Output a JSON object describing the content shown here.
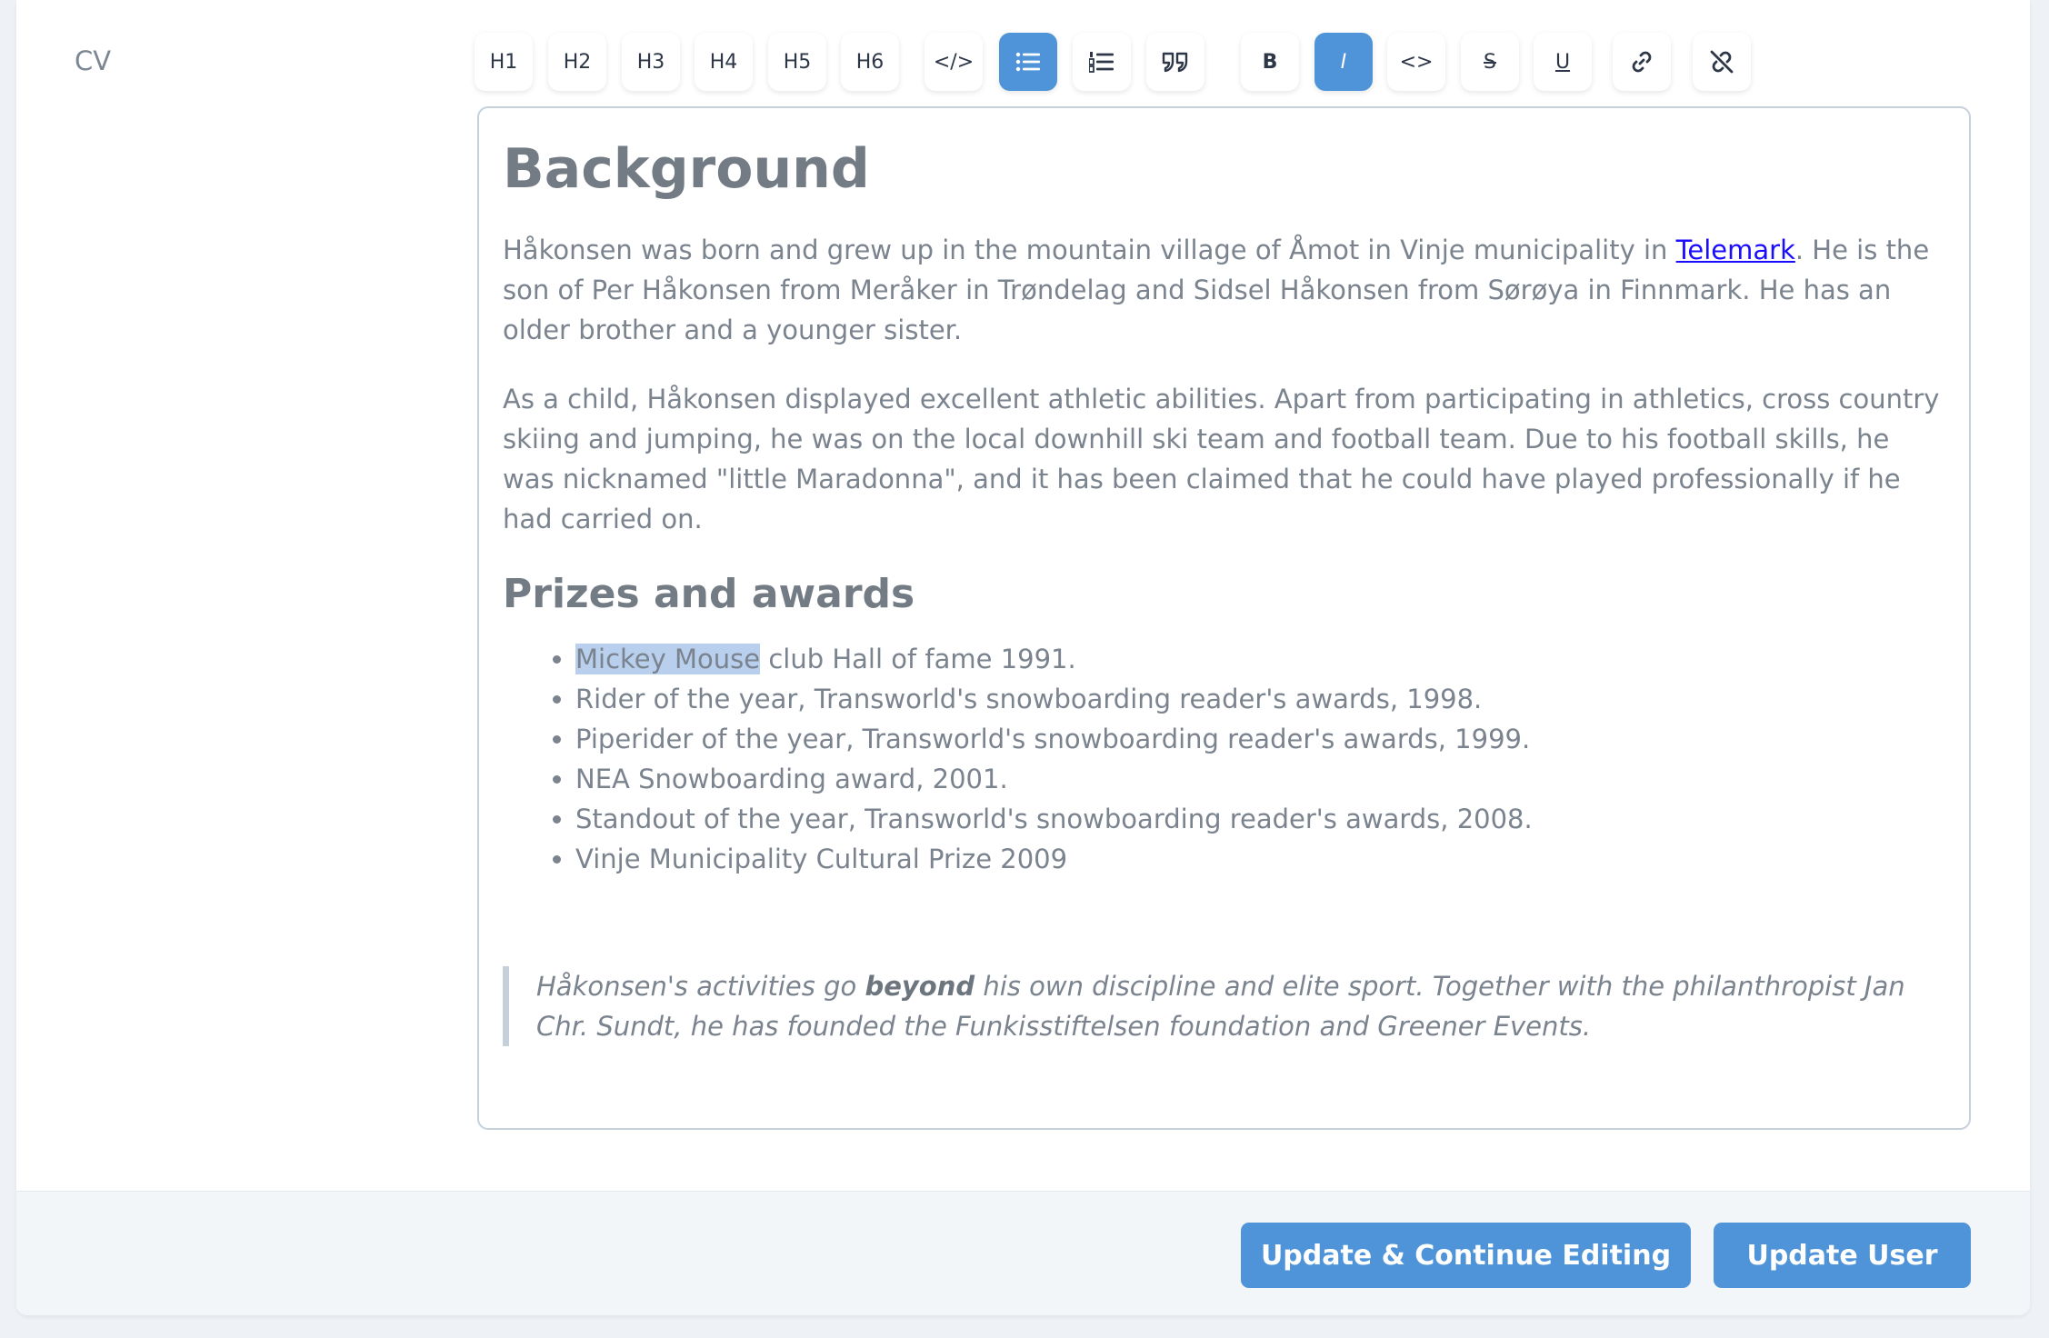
{
  "field": {
    "label": "CV"
  },
  "toolbar": {
    "h1": "H1",
    "h2": "H2",
    "h3": "H3",
    "h4": "H4",
    "h5": "H5",
    "h6": "H6",
    "code_block": "</>",
    "bold": "B",
    "italic": "I",
    "inline_code": "<>",
    "strike": "S",
    "underline": "U",
    "active_color": "#4f94d9"
  },
  "editor": {
    "heading": "Background",
    "p1_before_link": "Håkonsen was born and grew up in the mountain village of Åmot in Vinje municipality in ",
    "p1_link": "Telemark",
    "p1_after_link": ". He is the son of Per Håkonsen from Meråker in Trøndelag and Sidsel Håkonsen from Sørøya in Finnmark. He has an older brother and a younger sister.",
    "p2": "As a child, Håkonsen displayed excellent athletic abilities. Apart from participating in athletics, cross country skiing and jumping, he was on the local downhill ski team and football team. Due to his football skills, he was nicknamed \"little Maradonna\", and it has been claimed that he could have played professionally if he had carried on.",
    "subheading": "Prizes and awards",
    "awards_first_selected": "Mickey Mouse",
    "awards_first_rest": " club Hall of fame 1991.",
    "awards": [
      "Rider of the year, Transworld's snowboarding reader's awards, 1998.",
      "Piperider of the year, Transworld's snowboarding reader's awards, 1999.",
      "NEA Snowboarding award, 2001.",
      "Standout of the year, Transworld's snowboarding reader's awards, 2008.",
      "Vinje Municipality Cultural Prize 2009"
    ],
    "quote_before_bold": "Håkonsen's activities go ",
    "quote_bold": "beyond",
    "quote_after_bold": " his own discipline and elite sport. Together with the philanthropist Jan Chr. Sundt, he has founded the Funkisstiftelsen foundation and Greener Events."
  },
  "footer": {
    "update_continue_label": "Update & Continue Editing",
    "update_user_label": "Update User"
  }
}
